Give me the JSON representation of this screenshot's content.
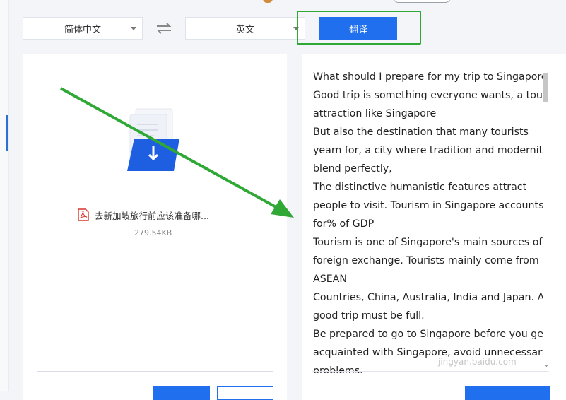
{
  "toolbar": {
    "source_language": "简体中文",
    "target_language": "英文",
    "translate_label": "翻译"
  },
  "left_panel": {
    "file_name": "去新加坡旅行前应该准备哪...",
    "file_size": "279.54KB"
  },
  "right_panel": {
    "lines": [
      "What should I prepare for my trip to Singapore?",
      "Good trip is something everyone wants, a tourist",
      "attraction like Singapore",
      "But also the destination that many tourists",
      "yearn for, a city where tradition and modernity",
      "blend perfectly,",
      "The distinctive humanistic features attract",
      "people to visit. Tourism in Singapore accounts",
      "for% of GDP",
      "Tourism is one of Singapore's main sources of",
      "foreign exchange. Tourists mainly come from",
      "ASEAN",
      "Countries, China, Australia, India and Japan. A",
      "good trip must be full.",
      "Be prepared to go to Singapore before you get",
      "acquainted with Singapore, avoid unnecessary",
      "problems."
    ]
  },
  "watermark": "jingyan.baidu.com",
  "colors": {
    "accent": "#1f6fef",
    "highlight_box": "#2fa836",
    "annotation_arrow": "#2fa836"
  }
}
